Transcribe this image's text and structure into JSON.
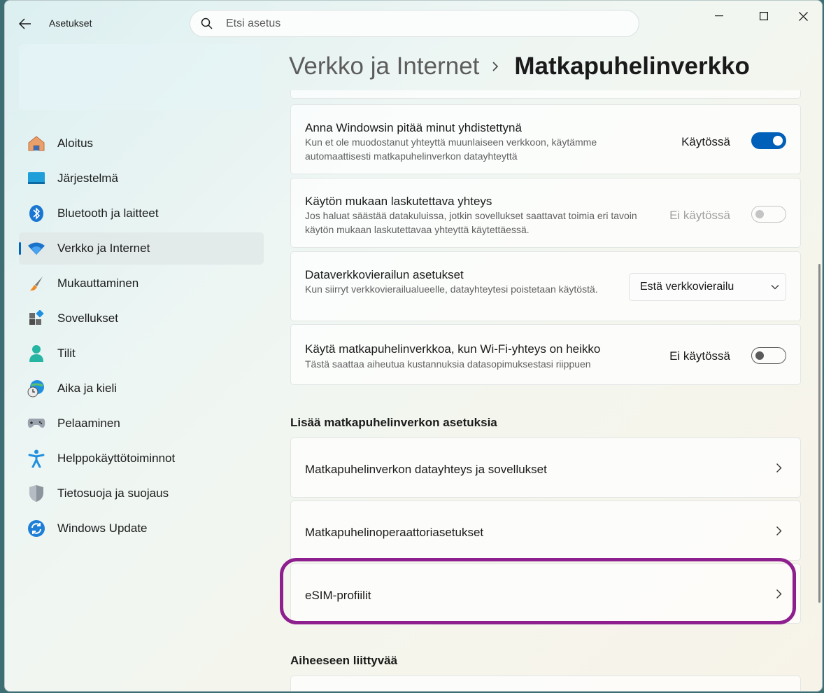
{
  "window": {
    "title": "Asetukset"
  },
  "search": {
    "placeholder": "Etsi asetus"
  },
  "sidebar": {
    "items": [
      {
        "label": "Aloitus",
        "icon": "home-icon"
      },
      {
        "label": "Järjestelmä",
        "icon": "system-icon"
      },
      {
        "label": "Bluetooth ja laitteet",
        "icon": "bluetooth-icon"
      },
      {
        "label": "Verkko ja Internet",
        "icon": "wifi-icon",
        "active": true
      },
      {
        "label": "Mukauttaminen",
        "icon": "brush-icon"
      },
      {
        "label": "Sovellukset",
        "icon": "apps-icon"
      },
      {
        "label": "Tilit",
        "icon": "person-icon"
      },
      {
        "label": "Aika ja kieli",
        "icon": "globe-clock-icon"
      },
      {
        "label": "Pelaaminen",
        "icon": "gamepad-icon"
      },
      {
        "label": "Helppokäyttötoiminnot",
        "icon": "accessibility-icon"
      },
      {
        "label": "Tietosuoja ja suojaus",
        "icon": "shield-icon"
      },
      {
        "label": "Windows Update",
        "icon": "update-icon"
      }
    ]
  },
  "breadcrumb": {
    "parent": "Verkko ja Internet",
    "current": "Matkapuhelinverkko"
  },
  "settings": {
    "stay_connected": {
      "title": "Anna Windowsin pitää minut yhdistettynä",
      "desc": "Kun et ole muodostanut yhteyttä muunlaiseen verkkoon, käytämme automaattisesti matkapuhelinverkon datayhteyttä",
      "state": "Käytössä"
    },
    "metered": {
      "title": "Käytön mukaan laskutettava yhteys",
      "desc": "Jos haluat säästää datakuluissa, jotkin sovellukset saattavat toimia eri tavoin käytön mukaan laskutettavaa yhteyttä käytettäessä.",
      "state": "Ei käytössä"
    },
    "roaming": {
      "title": "Dataverkkovierailun asetukset",
      "desc": "Kun siirryt verkkovierailualueelle, datayhteytesi poistetaan käytöstä.",
      "value": "Estä verkkovierailu"
    },
    "weak_wifi": {
      "title": "Käytä matkapuhelinverkkoa, kun Wi-Fi-yhteys on heikko",
      "desc": "Tästä saattaa aiheutua kustannuksia datasopimuksestasi riippuen",
      "state": "Ei käytössä"
    }
  },
  "more_section": {
    "header": "Lisää matkapuhelinverkon asetuksia",
    "links": [
      "Matkapuhelinverkon datayhteys ja sovellukset",
      "Matkapuhelinoperaattoriasetukset",
      "eSIM-profiilit"
    ]
  },
  "related_section": {
    "header": "Aiheeseen liittyvää"
  },
  "colors": {
    "accent": "#005fb8",
    "highlight": "#8e1f8e"
  }
}
